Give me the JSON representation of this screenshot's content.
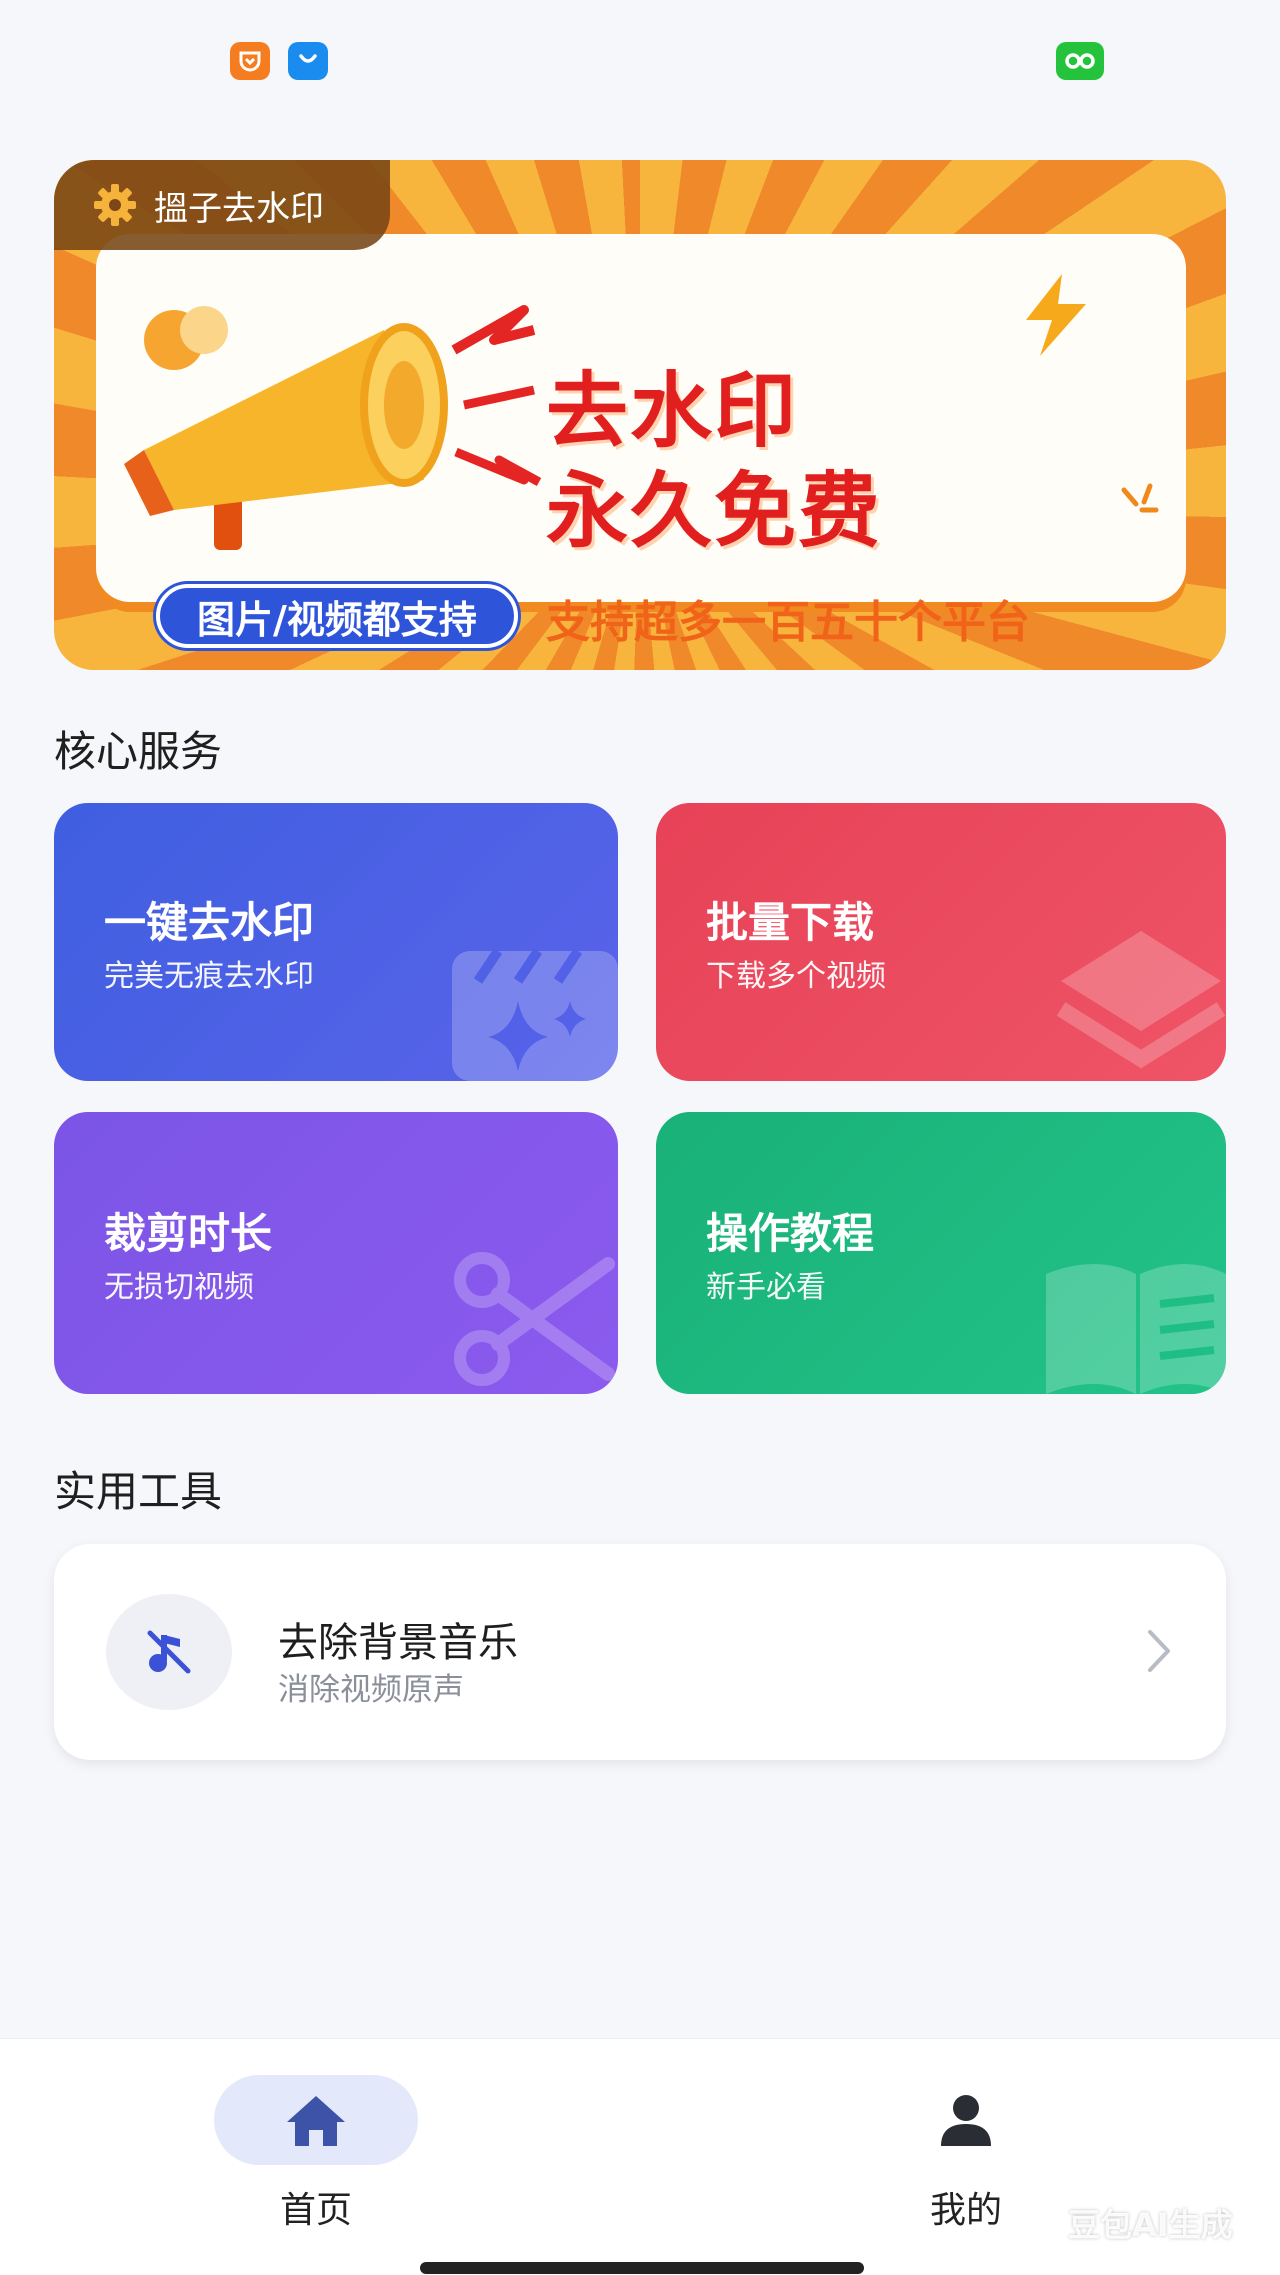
{
  "banner": {
    "tag": "搵子去水印",
    "headline_1": "去水印",
    "headline_2": "永久免费",
    "pill": "图片/视频都支持",
    "platforms": "支持超多一百五十个平台"
  },
  "sections": {
    "core": "核心服务",
    "tools": "实用工具"
  },
  "services": [
    {
      "title": "一键去水印",
      "subtitle": "完美无痕去水印",
      "icon": "clapperboard-sparkle-icon",
      "color": "#4a5fe4"
    },
    {
      "title": "批量下载",
      "subtitle": "下载多个视频",
      "icon": "layers-icon",
      "color": "#ea485c"
    },
    {
      "title": "裁剪时长",
      "subtitle": "无损切视频",
      "icon": "scissors-icon",
      "color": "#8157ea"
    },
    {
      "title": "操作教程",
      "subtitle": "新手必看",
      "icon": "book-icon",
      "color": "#1cb87f"
    }
  ],
  "tools": [
    {
      "title": "去除背景音乐",
      "subtitle": "消除视频原声",
      "icon": "music-off-icon"
    }
  ],
  "nav": {
    "home": "首页",
    "mine": "我的",
    "active": "home"
  },
  "watermark": "豆包AI生成"
}
